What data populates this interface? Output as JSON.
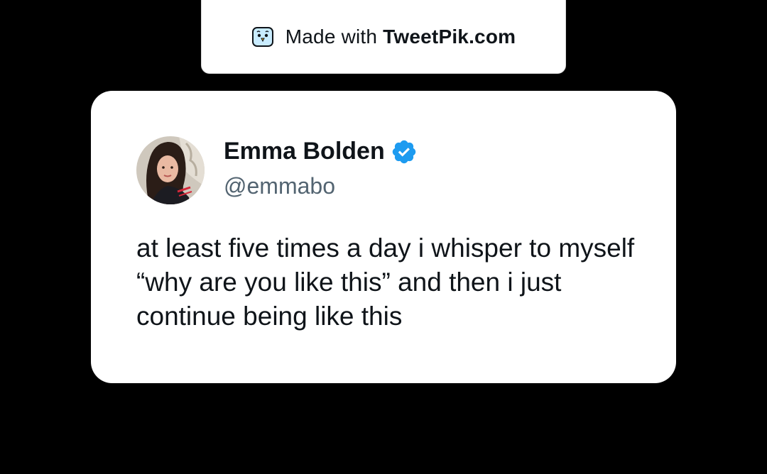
{
  "watermark": {
    "prefix": "Made with",
    "brand": "TweetPik.com",
    "icon": "tweetpik-bird-icon"
  },
  "tweet": {
    "author": {
      "name": "Emma Bolden",
      "handle": "@emmabo",
      "verified": true,
      "avatar_icon": "profile-photo"
    },
    "text": "at least five times a day i whisper to myself “why are you like this” and then i just continue being like this"
  },
  "colors": {
    "background": "#000000",
    "card": "#ffffff",
    "text_primary": "#0f1419",
    "text_secondary": "#536471",
    "verified_blue": "#1d9bf0"
  }
}
